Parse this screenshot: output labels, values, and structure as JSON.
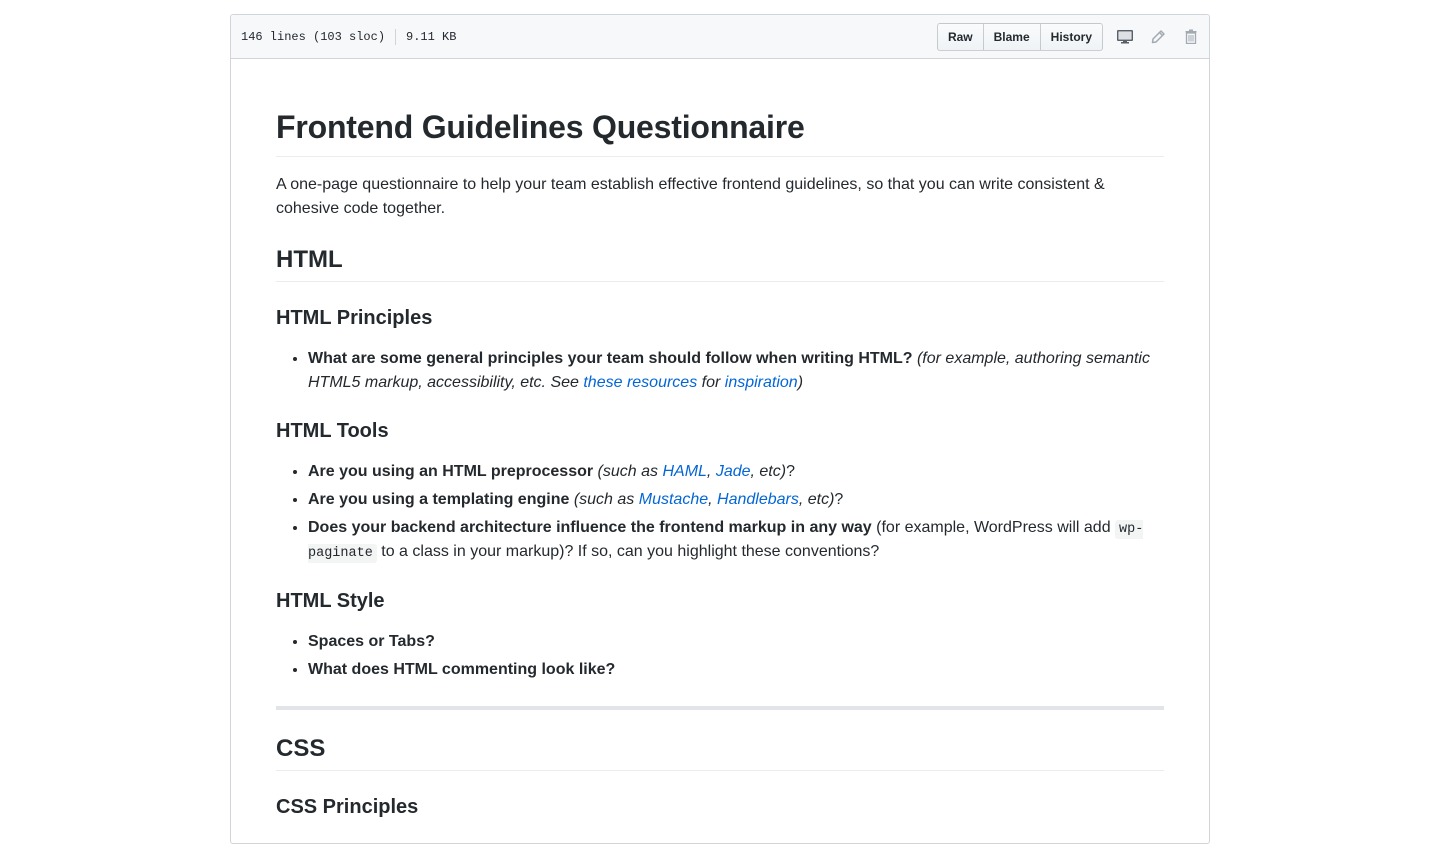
{
  "file_header": {
    "lines": "146 lines (103 sloc)",
    "size": "9.11 KB",
    "raw_label": "Raw",
    "blame_label": "Blame",
    "history_label": "History",
    "icons": [
      "desktop-icon",
      "pencil-icon",
      "trashcan-icon"
    ]
  },
  "readme": {
    "title": "Frontend Guidelines Questionnaire",
    "intro": "A one-page questionnaire to help your team establish effective frontend guidelines, so that you can write consistent & cohesive code together.",
    "html": {
      "heading": "HTML",
      "principles": {
        "heading": "HTML Principles",
        "item1": {
          "bold": "What are some general principles your team should follow when writing HTML?",
          "em_pre": "(for example, authoring semantic HTML5 markup, accessibility, etc. See ",
          "link1": "these resources",
          "em_mid": " for ",
          "link2": "inspiration",
          "em_post": ")"
        }
      },
      "tools": {
        "heading": "HTML Tools",
        "item1": {
          "bold": "Are you using an HTML preprocessor",
          "em_pre": "(such as ",
          "link1": "HAML",
          "sep": ", ",
          "link2": "Jade",
          "em_post": ", etc)",
          "tail": "?"
        },
        "item2": {
          "bold": "Are you using a templating engine",
          "em_pre": "(such as ",
          "link1": "Mustache",
          "sep": ", ",
          "link2": "Handlebars",
          "em_post": ", etc)",
          "tail": "?"
        },
        "item3": {
          "bold": "Does your backend architecture influence the frontend markup in any way",
          "text_pre": " (for example, WordPress will add ",
          "code": "wp-paginate",
          "text_post": " to a class in your markup)? If so, can you highlight these conventions?"
        }
      },
      "style": {
        "heading": "HTML Style",
        "items": [
          "Spaces or Tabs?",
          "What does HTML commenting look like?"
        ]
      }
    },
    "css": {
      "heading": "CSS",
      "principles_heading": "CSS Principles"
    }
  }
}
